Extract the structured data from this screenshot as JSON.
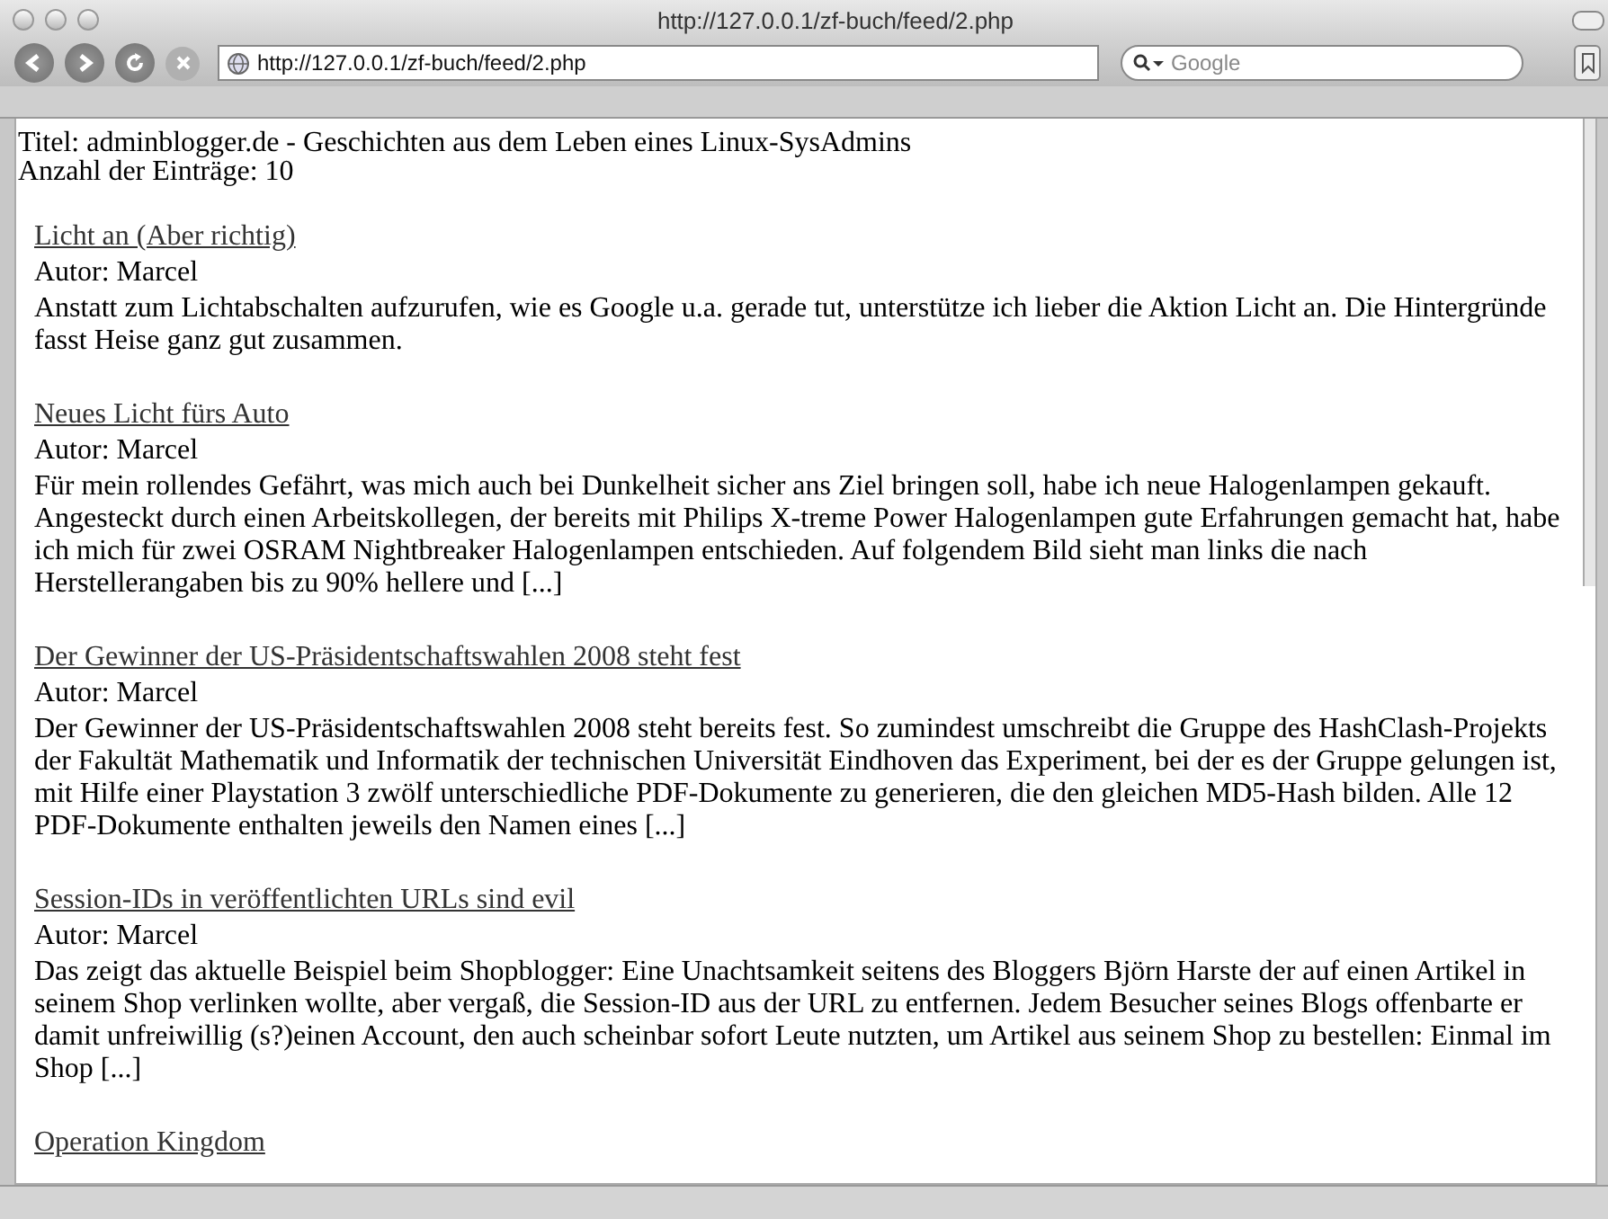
{
  "window": {
    "title": "http://127.0.0.1/zf-buch/feed/2.php"
  },
  "toolbar": {
    "address": "http://127.0.0.1/zf-buch/feed/2.php",
    "search_placeholder": "Google"
  },
  "page": {
    "feed_title": "Titel: adminblogger.de - Geschichten aus dem Leben eines Linux-SysAdmins",
    "entry_count": "Anzahl der Einträge: 10",
    "entries": [
      {
        "title": "Licht an (Aber richtig)",
        "author": "Autor: Marcel",
        "summary": "Anstatt zum Lichtabschalten aufzurufen, wie es Google u.a. gerade tut, unterstütze ich lieber die Aktion Licht an. Die Hintergründe fasst Heise ganz gut zusammen."
      },
      {
        "title": "Neues Licht fürs Auto",
        "author": "Autor: Marcel",
        "summary": "Für mein rollendes Gefährt, was mich auch bei Dunkelheit sicher ans Ziel bringen soll, habe ich neue Halogenlampen gekauft. Angesteckt durch einen Arbeitskollegen, der bereits mit Philips X-treme Power Halogenlampen gute Erfahrungen gemacht hat, habe ich mich für zwei OSRAM Nightbreaker Halogenlampen entschieden. Auf folgendem Bild sieht man links die nach Herstellerangaben bis zu 90% hellere und [...]"
      },
      {
        "title": "Der Gewinner der US-Präsidentschaftswahlen 2008 steht fest",
        "author": "Autor: Marcel",
        "summary": "Der Gewinner der US-Präsidentschaftswahlen 2008 steht bereits fest. So zumindest umschreibt die Gruppe des HashClash-Projekts der Fakultät Mathematik und Informatik der technischen Universität Eindhoven das Experiment, bei der es der Gruppe gelungen ist, mit Hilfe einer Playstation 3 zwölf unterschiedliche PDF-Dokumente zu generieren, die den gleichen MD5-Hash bilden. Alle 12 PDF-Dokumente enthalten jeweils den Namen eines [...]"
      },
      {
        "title": "Session-IDs in veröffentlichten URLs sind evil",
        "author": "Autor: Marcel",
        "summary": "Das zeigt das aktuelle Beispiel beim Shopblogger: Eine Unachtsamkeit seitens des Bloggers Björn Harste der auf einen Artikel in seinem Shop verlinken wollte, aber vergaß, die Session-ID aus der URL zu entfernen. Jedem Besucher seines Blogs offenbarte er damit unfreiwillig (s?)einen Account, den auch scheinbar sofort Leute nutzten, um Artikel aus seinem Shop zu bestellen: Einmal im Shop [...]"
      },
      {
        "title": "Operation Kingdom"
      }
    ]
  }
}
